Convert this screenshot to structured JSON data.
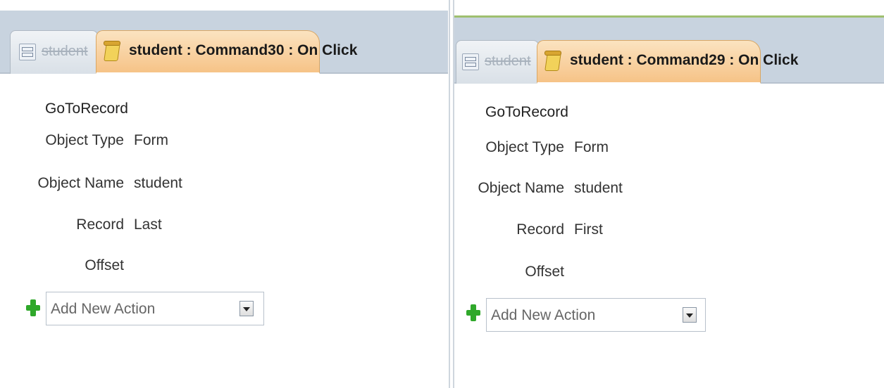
{
  "left": {
    "tabs": {
      "inactive_label": "student",
      "active_label": "student : Command30 : On Click"
    },
    "action": {
      "name": "GoToRecord",
      "arguments": [
        {
          "label": "Object Type",
          "value": "Form"
        },
        {
          "label": "Object Name",
          "value": "student"
        },
        {
          "label": "Record",
          "value": "Last"
        },
        {
          "label": "Offset",
          "value": ""
        }
      ]
    },
    "add_action": {
      "placeholder": "Add New Action"
    }
  },
  "right": {
    "tabs": {
      "inactive_label": "student",
      "active_label": "student : Command29 : On Click"
    },
    "action": {
      "name": "GoToRecord",
      "arguments": [
        {
          "label": "Object Type",
          "value": "Form"
        },
        {
          "label": "Object Name",
          "value": "student"
        },
        {
          "label": "Record",
          "value": "First"
        },
        {
          "label": "Offset",
          "value": ""
        }
      ]
    },
    "add_action": {
      "placeholder": "Add New Action"
    }
  },
  "icons": {
    "inactive_tab": "form-icon",
    "active_tab": "macro-icon",
    "add": "green-plus-icon",
    "dropdown": "chevron-down-icon"
  },
  "colors": {
    "tabstrip": "#c8d3df",
    "active_tab": "#f6c387",
    "plus": "#2fa82a"
  }
}
